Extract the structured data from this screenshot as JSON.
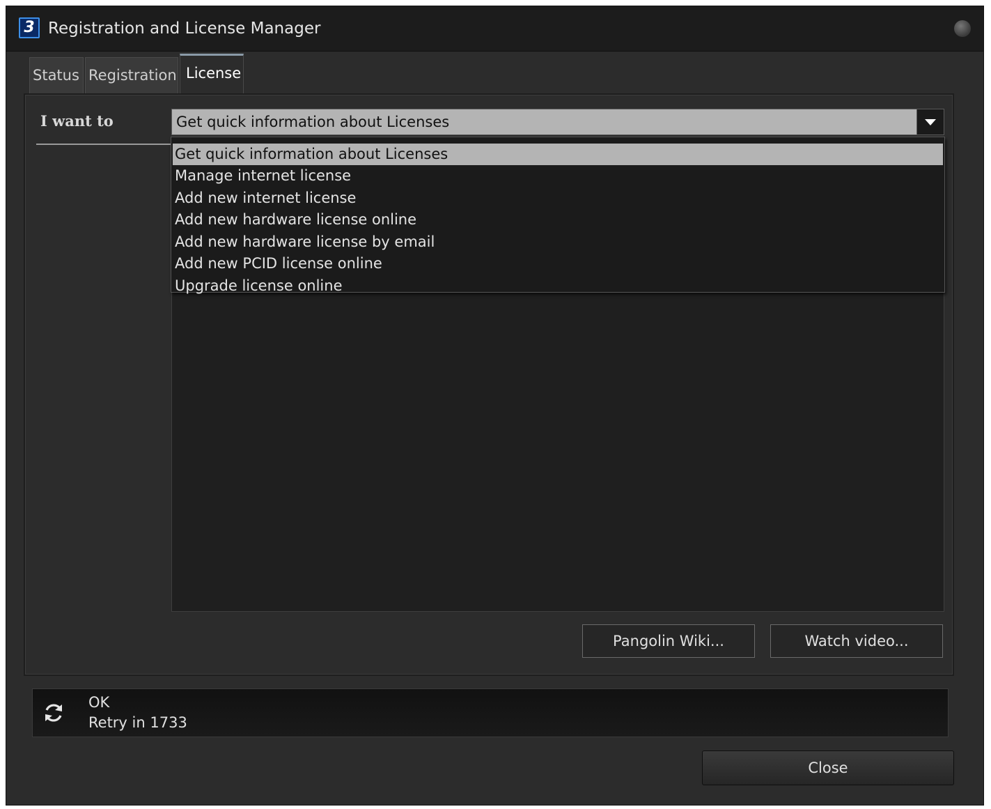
{
  "window": {
    "title": "Registration and License Manager",
    "app_icon_glyph": "3"
  },
  "tabs": [
    {
      "label": "Status",
      "active": false
    },
    {
      "label": "Registration",
      "active": false
    },
    {
      "label": "License",
      "active": true
    }
  ],
  "license": {
    "i_want_to_label": "I want to",
    "selected_option": "Get quick information about Licenses",
    "options": [
      "Get quick information about Licenses",
      "Manage internet license",
      "Add new internet license",
      "Add new hardware license online",
      "Add new hardware license by email",
      "Add new PCID license online",
      "Upgrade license online"
    ],
    "pangolin_wiki_label": "Pangolin Wiki...",
    "watch_video_label": "Watch video..."
  },
  "status": {
    "line1": "OK",
    "line2": "Retry in 1733",
    "icon": "refresh-icon"
  },
  "footer": {
    "close_label": "Close"
  },
  "colors": {
    "window_bg": "#2c2c2c",
    "titlebar_bg": "#1c1c1c",
    "selection_bg": "#b4b4b4",
    "icon_accent": "#3d8fe8"
  }
}
